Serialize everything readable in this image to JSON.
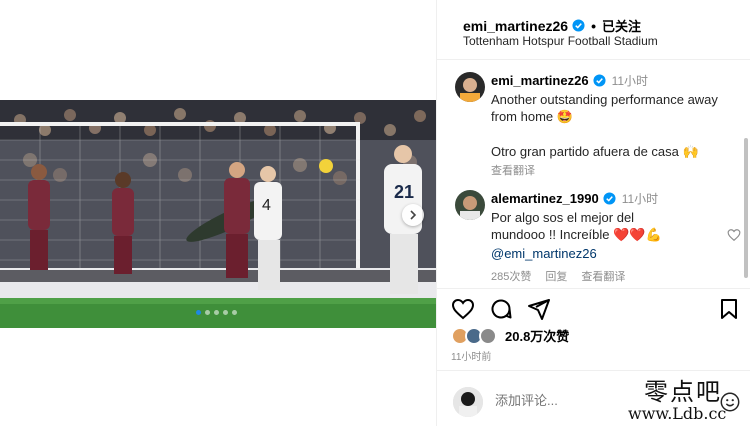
{
  "header": {
    "username": "emi_martinez26",
    "follow_state": "已关注",
    "location": "Tottenham Hotspur Football Stadium"
  },
  "media": {
    "carousel": {
      "count": 5,
      "active_index": 0
    },
    "scoreboard_players": [
      "4",
      "21"
    ]
  },
  "comments": [
    {
      "username": "emi_martinez26",
      "time": "11小时",
      "text": "Another outstanding performance away from home 🤩",
      "text2": "Otro gran partido afuera de casa 🙌",
      "translate": "查看翻译"
    },
    {
      "username": "alemartinez_1990",
      "time": "11小时",
      "text": "Por algo sos el mejor del mundooo !! Increíble ❤️❤️💪",
      "mention": "@emi_martinez26",
      "likes": "285次赞",
      "reply": "回复",
      "translate": "查看翻译"
    }
  ],
  "likes": {
    "count_text": "20.8万次赞"
  },
  "post_time": "11小时前",
  "composer": {
    "placeholder": "添加评论..."
  },
  "watermark": {
    "cn": "零点吧",
    "url": "www.Ldb.cc"
  },
  "icons": {
    "verified": "verified-badge-icon",
    "heart": "heart-icon",
    "comment": "comment-icon",
    "share": "share-icon",
    "save": "bookmark-icon",
    "emoji": "emoji-icon",
    "next": "chevron-right-icon"
  },
  "colors": {
    "verified": "#0095f6",
    "muted": "#8e8e8e",
    "mention": "#00376b",
    "carousel_active": "#1e88e5"
  }
}
